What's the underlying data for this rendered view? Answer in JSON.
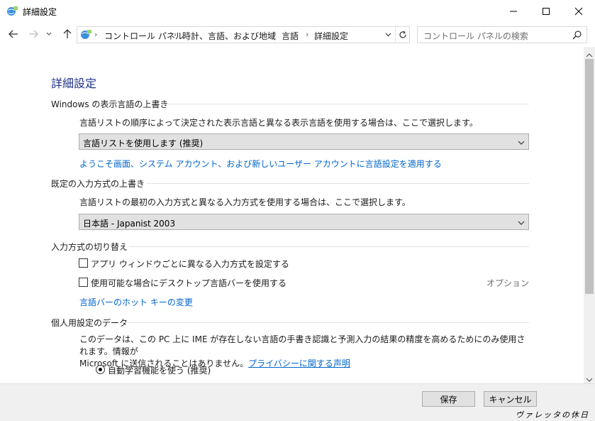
{
  "window": {
    "title": "詳細設定"
  },
  "addressbar": {
    "crumbs": [
      "コントロール パネル",
      "時計、言語、および地域",
      "言語",
      "詳細設定"
    ],
    "separator": "›",
    "search_placeholder": "コントロール パネルの検索"
  },
  "page": {
    "title": "詳細設定",
    "sections": {
      "display_lang": {
        "heading": "Windows の表示言語の上書き",
        "description": "言語リストの順序によって決定された表示言語と異なる表示言語を使用する場合は、ここで選択します。",
        "select_value": "言語リストを使用します (推奨)",
        "link": "ようこそ画面、システム アカウント、および新しいユーザー アカウントに言語設定を適用する"
      },
      "input_method": {
        "heading": "既定の入力方式の上書き",
        "description": "言語リストの最初の入力方式と異なる入力方式を使用する場合は、ここで選択します。",
        "select_value": "日本語 - Japanist 2003"
      },
      "switching": {
        "heading": "入力方式の切り替え",
        "checkbox1_label": "アプリ ウィンドウごとに異なる入力方式を設定する",
        "checkbox1_checked": false,
        "checkbox2_label": "使用可能な場合にデスクトップ言語バーを使用する",
        "checkbox2_checked": false,
        "options_link": "オプション",
        "hotkey_link": "言語バーのホット キーの変更"
      },
      "personal": {
        "heading": "個人用設定のデータ",
        "paragraph_line1": "このデータは、この PC 上に IME が存在しない言語の手書き認識と予測入力の結果の精度を高めるためにのみ使用されます。情報が",
        "paragraph_line2": "Microsoft に送信されることはありません。",
        "privacy_link": "プライバシーに関する声明",
        "radio_label": "自動学習機能を使う (推奨)",
        "radio_selected": true
      }
    }
  },
  "footer": {
    "save_label": "保存",
    "cancel_label": "キャンセル",
    "watermark": "ヴァレッタの休日"
  },
  "colors": {
    "title": "#1e3287",
    "link": "#0066cc",
    "footer_bg": "#f0f0f0"
  }
}
